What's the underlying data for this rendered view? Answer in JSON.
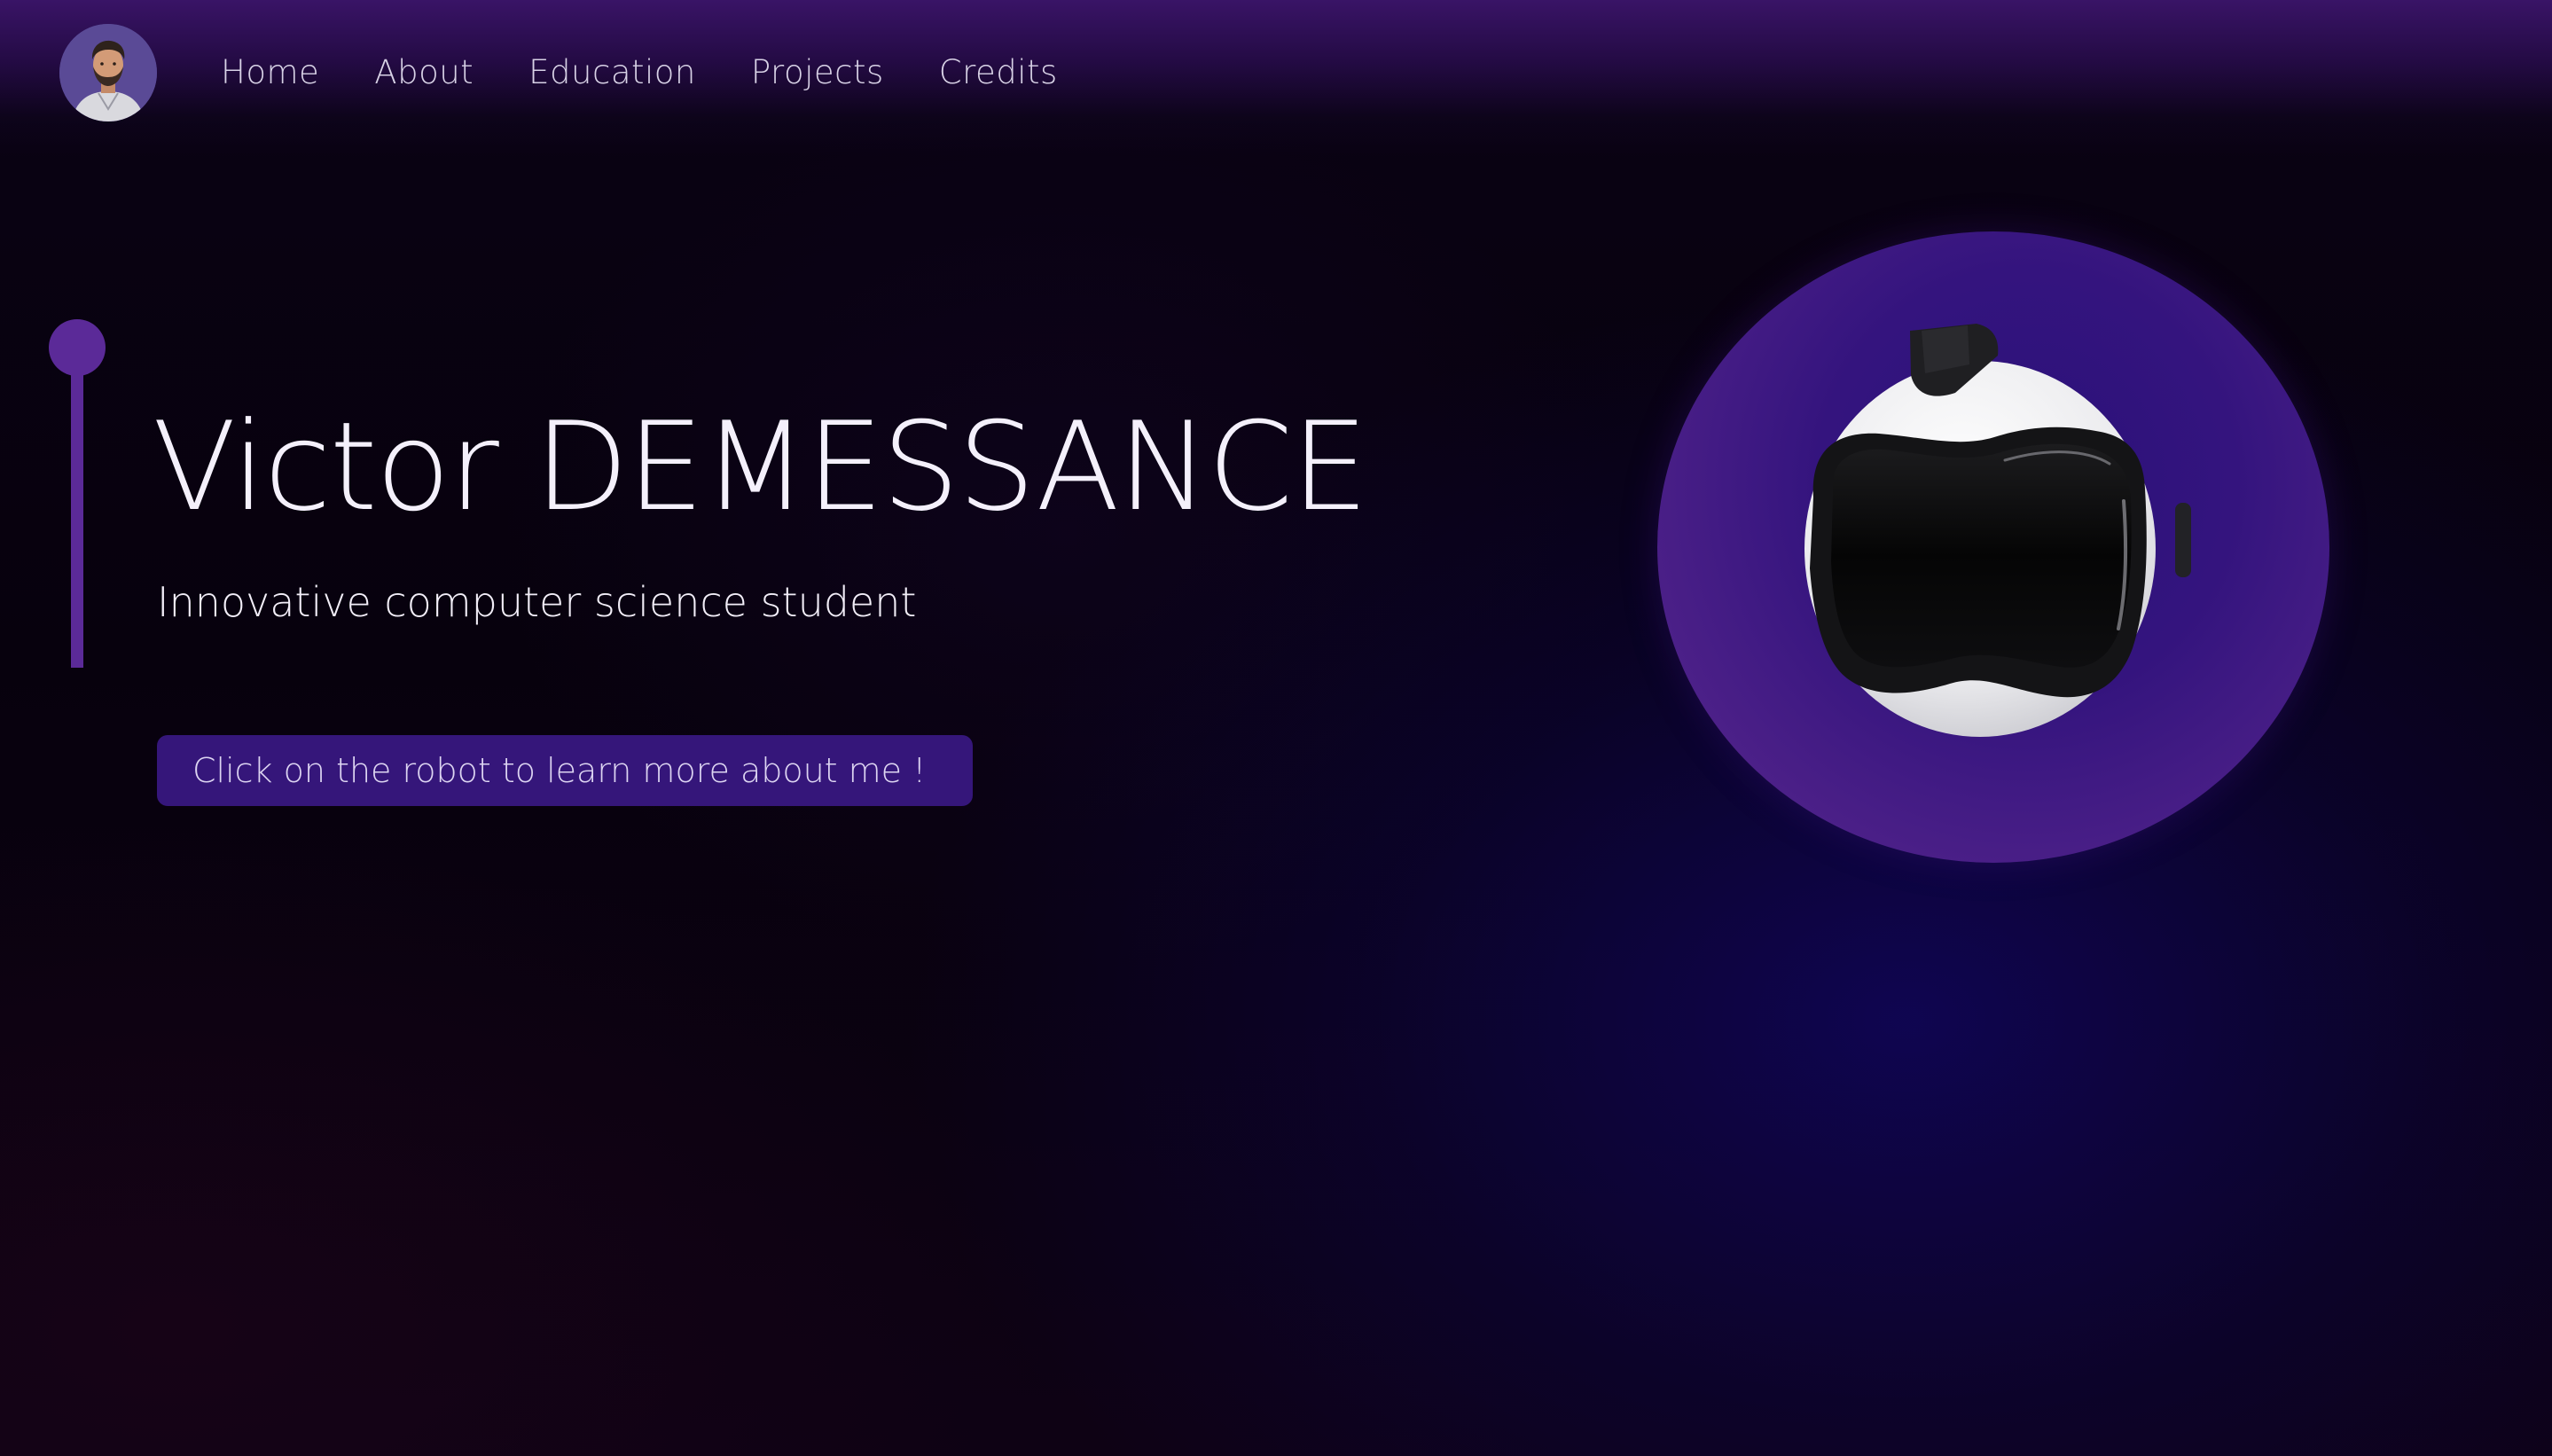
{
  "header": {
    "avatar_icon": "profile-avatar",
    "nav": [
      {
        "label": "Home"
      },
      {
        "label": "About"
      },
      {
        "label": "Education"
      },
      {
        "label": "Projects"
      },
      {
        "label": "Credits"
      }
    ]
  },
  "hero": {
    "title": "Victor DEMESSANCE",
    "subtitle": "Innovative computer science student",
    "cta_label": "Click on the robot to learn more about me !"
  },
  "robot": {
    "icon": "robot-head-icon"
  },
  "colors": {
    "accent": "#5b2a98",
    "button": "#35167a",
    "orb": "#3a1680"
  }
}
